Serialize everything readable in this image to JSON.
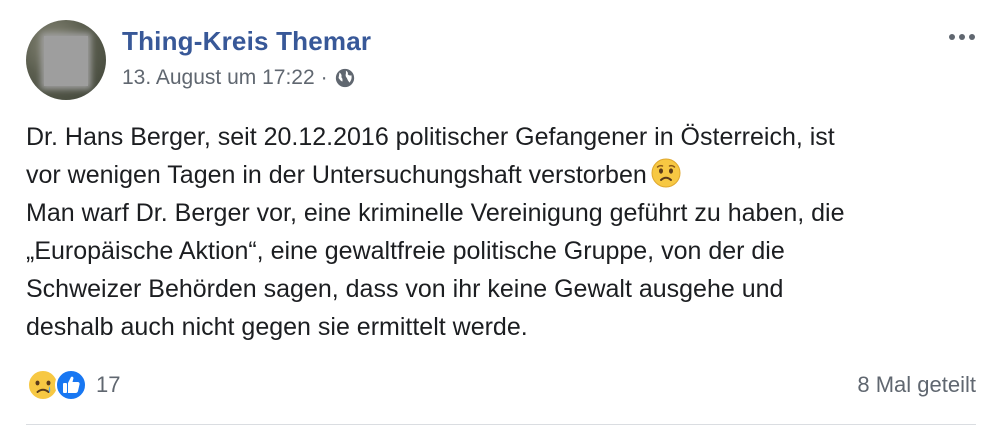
{
  "post": {
    "page_name": "Thing-Kreis Themar",
    "timestamp": "13. August um 17:22",
    "separator": "·",
    "privacy_icon": "globe-icon",
    "text_lines": [
      "Dr. Hans Berger, seit 20.12.2016 politischer Gefangener in Österreich, ist",
      "vor wenigen Tagen in der Untersuchungshaft verstorben",
      "Man warf Dr. Berger vor, eine kriminelle Vereinigung geführt zu haben, die",
      "„Europäische Aktion“, eine gewaltfreie politische Gruppe, von der die",
      "Schweizer Behörden sagen, dass von ihr keine Gewalt ausgehe und",
      "deshalb auch nicht gegen sie ermittelt werde."
    ],
    "inline_emoji": "sad-face-emoji"
  },
  "footer": {
    "reaction_icons": [
      "sad-reaction-icon",
      "like-reaction-icon"
    ],
    "reaction_count": "17",
    "shares": "8 Mal geteilt"
  },
  "colors": {
    "name": "#385898",
    "meta": "#606770",
    "text": "#1c1e21",
    "like": "#1877f2",
    "emoji": "#f7c843"
  }
}
